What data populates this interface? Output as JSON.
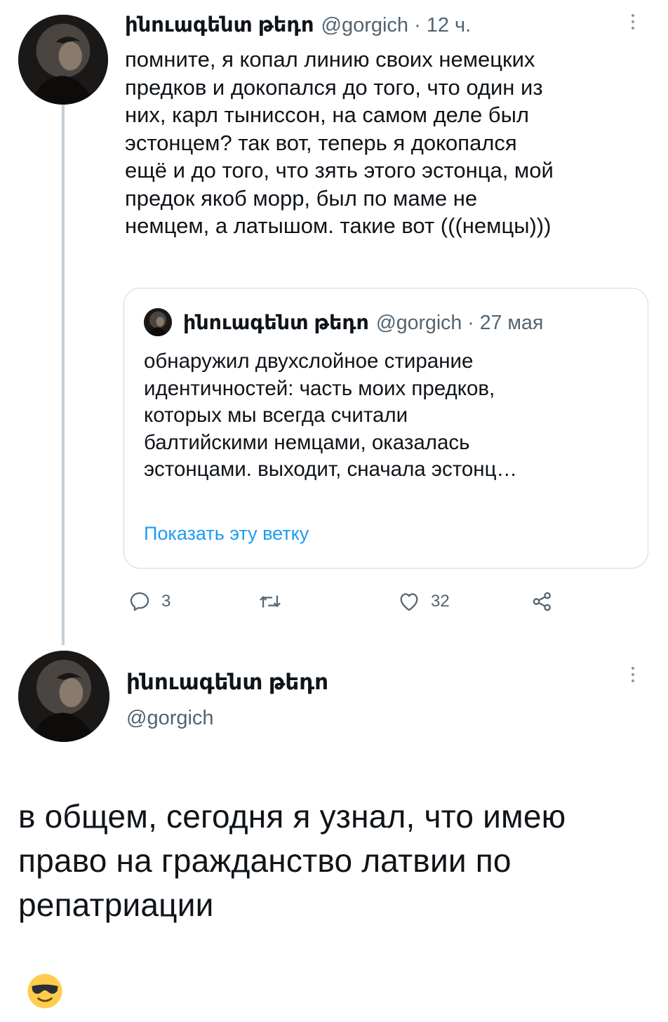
{
  "tweet1": {
    "display_name": "ինուագենտ թեդո",
    "handle": "@gorgich",
    "separator": "·",
    "time": "12 ч.",
    "text": "помните, я копал линию своих немецких\nпредков и докопался до того, что один из\nних, карл тыниссон, на самом деле был\nэстонцем? так вот, теперь я докопался\nещё и до того, что зять этого эстонца, мой\nпредок якоб морр, был по маме не\nнемцем, а латышом. такие вот (((немцы)))",
    "quote": {
      "display_name": "ինուագենտ թեդո",
      "handle": "@gorgich",
      "separator": "·",
      "date": "27 мая",
      "text": "обнаружил двухслойное стирание\nидентичностей: часть моих предков,\nкоторых мы всегда считали\nбалтийскими немцами, оказалась\nэстонцами. выходит, сначала эстонц…",
      "show_thread": "Показать эту ветку"
    },
    "actions": {
      "reply_icon": "reply-icon",
      "reply_count": "3",
      "retweet_icon": "retweet-icon",
      "like_icon": "heart-icon",
      "like_count": "32",
      "share_icon": "share-icon"
    }
  },
  "tweet2": {
    "display_name": "ինուագենտ թեդո",
    "handle": "@gorgich",
    "text": "в общем, сегодня я узнал, что имею\nправо на гражданство латвии по\nрепатриации",
    "emoji_icon": "smiling-face-with-sunglasses-icon"
  },
  "colors": {
    "text": "#0f1419",
    "muted": "#536471",
    "link": "#1d9bf0",
    "border": "#cfd9de",
    "thread_line": "#c4cfd6"
  }
}
